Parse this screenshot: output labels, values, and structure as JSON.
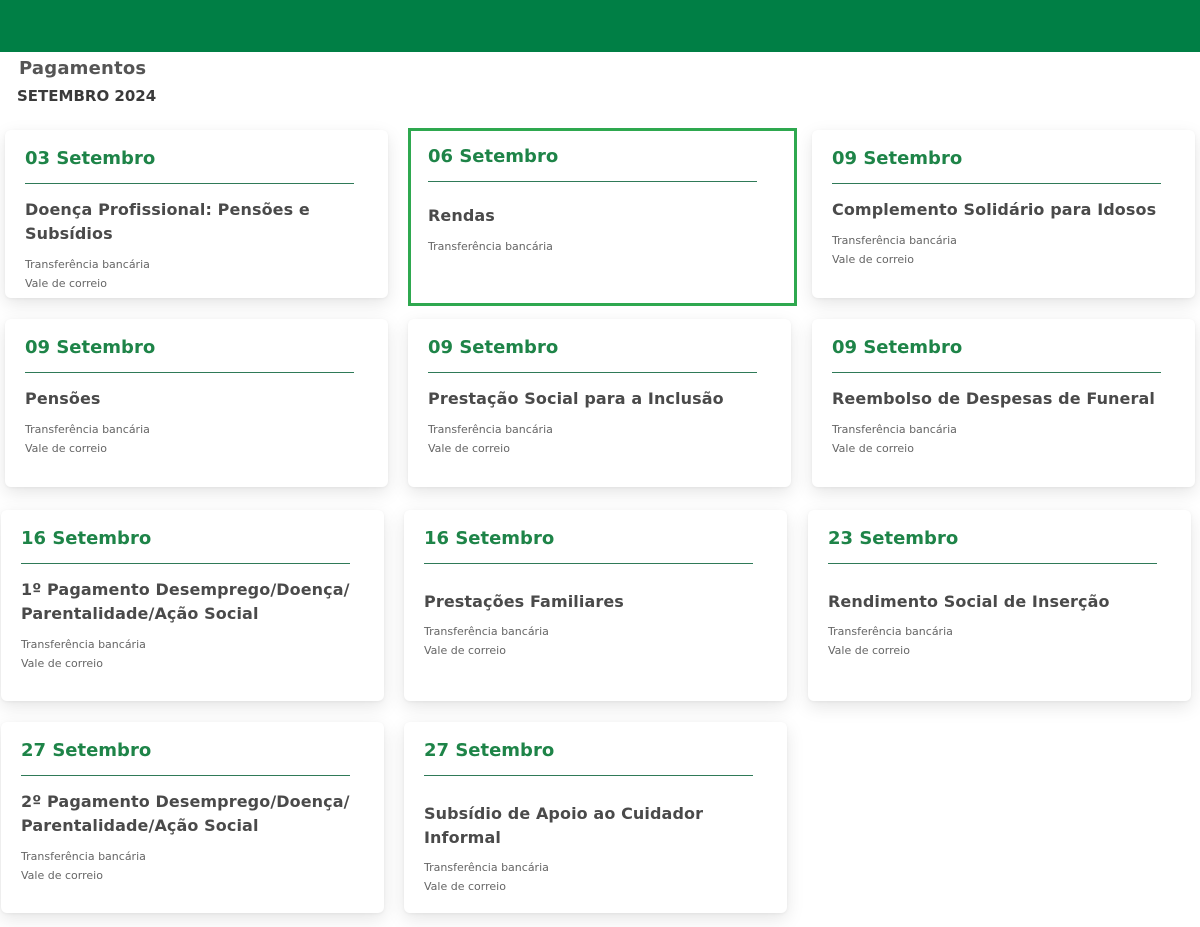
{
  "header": {
    "title": "Pagamentos",
    "subtitle": "SETEMBRO 2024"
  },
  "theme": {
    "brand": "#007f45",
    "date_color": "#1e8448",
    "selected_border": "#2ea84f"
  },
  "cards": [
    {
      "date": "03 Setembro",
      "title": "Doença Profissional: Pensões e Subsídios",
      "methods": [
        "Transferência bancária",
        "Vale de correio"
      ]
    },
    {
      "date": "06 Setembro",
      "title": "Rendas",
      "methods": [
        "Transferência bancária"
      ]
    },
    {
      "date": "09 Setembro",
      "title": "Complemento Solidário para Idosos",
      "methods": [
        "Transferência bancária",
        "Vale de correio"
      ]
    },
    {
      "date": "09 Setembro",
      "title": "Pensões",
      "methods": [
        "Transferência bancária",
        "Vale de correio"
      ]
    },
    {
      "date": "09 Setembro",
      "title": "Prestação Social para a Inclusão",
      "methods": [
        "Transferência bancária",
        "Vale de correio"
      ]
    },
    {
      "date": "09 Setembro",
      "title": "Reembolso de Despesas de Funeral",
      "methods": [
        "Transferência bancária",
        "Vale de correio"
      ]
    },
    {
      "date": "16 Setembro",
      "title": "1º Pagamento Desemprego/Doença/ Parentalidade/Ação Social",
      "methods": [
        "Transferência bancária",
        "Vale de correio"
      ]
    },
    {
      "date": "16 Setembro",
      "title": "Prestações Familiares",
      "methods": [
        "Transferência bancária",
        "Vale de correio"
      ]
    },
    {
      "date": "23 Setembro",
      "title": "Rendimento Social de Inserção",
      "methods": [
        "Transferência bancária",
        "Vale de correio"
      ]
    },
    {
      "date": "27 Setembro",
      "title": "2º Pagamento Desemprego/Doença/ Parentalidade/Ação Social",
      "methods": [
        "Transferência bancária",
        "Vale de correio"
      ]
    },
    {
      "date": "27 Setembro",
      "title": "Subsídio de Apoio ao Cuidador Informal",
      "methods": [
        "Transferência bancária",
        "Vale de correio"
      ]
    }
  ]
}
